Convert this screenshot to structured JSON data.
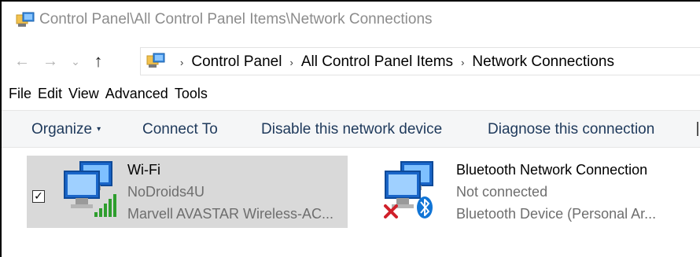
{
  "window": {
    "title": "Control Panel\\All Control Panel Items\\Network Connections"
  },
  "nav": {
    "back": "←",
    "forward": "→",
    "recent": "⌄",
    "up": "↑",
    "separator": "›",
    "breadcrumb": [
      "Control Panel",
      "All Control Panel Items",
      "Network Connections"
    ]
  },
  "menu": {
    "items": [
      "File",
      "Edit",
      "View",
      "Advanced",
      "Tools"
    ]
  },
  "commands": {
    "organize": "Organize",
    "organize_caret": "▾",
    "connect_to": "Connect To",
    "disable": "Disable this network device",
    "diagnose": "Diagnose this connection"
  },
  "connections": [
    {
      "name": "Wi-Fi",
      "status": "NoDroids4U",
      "device": "Marvell AVASTAR Wireless-AC...",
      "selected": true,
      "checked": "✓",
      "icon": "wifi-network-icon",
      "signal_bars": 5
    },
    {
      "name": "Bluetooth Network Connection",
      "status": "Not connected",
      "device": "Bluetooth Device (Personal Ar...",
      "selected": false,
      "icon": "bluetooth-network-icon"
    }
  ],
  "colors": {
    "command_text": "#1e395b",
    "selection_bg": "#d9d9d9",
    "secondary_text": "#6e6e6e",
    "signal_green": "#2e9e2e",
    "error_red": "#d0202a",
    "bluetooth_blue": "#1175d6"
  }
}
